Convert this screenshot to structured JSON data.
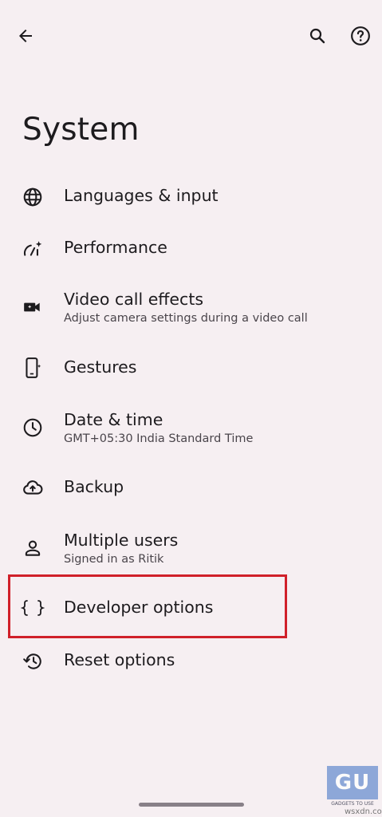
{
  "header": {
    "back_icon": "arrow-back-icon",
    "search_icon": "search-icon",
    "help_icon": "help-circle-icon"
  },
  "page": {
    "title": "System"
  },
  "items": [
    {
      "label": "Languages & input",
      "sub": "",
      "icon": "globe-icon"
    },
    {
      "label": "Performance",
      "sub": "",
      "icon": "performance-gauge-icon"
    },
    {
      "label": "Video call effects",
      "sub": "Adjust camera settings during a video call",
      "icon": "video-camera-icon"
    },
    {
      "label": "Gestures",
      "sub": "",
      "icon": "phone-gesture-icon"
    },
    {
      "label": "Date & time",
      "sub": "GMT+05:30 India Standard Time",
      "icon": "clock-icon"
    },
    {
      "label": "Backup",
      "sub": "",
      "icon": "cloud-upload-icon"
    },
    {
      "label": "Multiple users",
      "sub": "Signed in as Ritik",
      "icon": "person-icon"
    },
    {
      "label": "Developer options",
      "sub": "",
      "icon": "braces-icon"
    },
    {
      "label": "Reset options",
      "sub": "",
      "icon": "history-icon"
    }
  ],
  "watermark": {
    "logo_text": "GU",
    "text": "GADGETS TO USE"
  },
  "credit": "wsxdn.com",
  "colors": {
    "background": "#f6eff2",
    "highlight": "#d0202a",
    "text": "#1d1b1e"
  }
}
